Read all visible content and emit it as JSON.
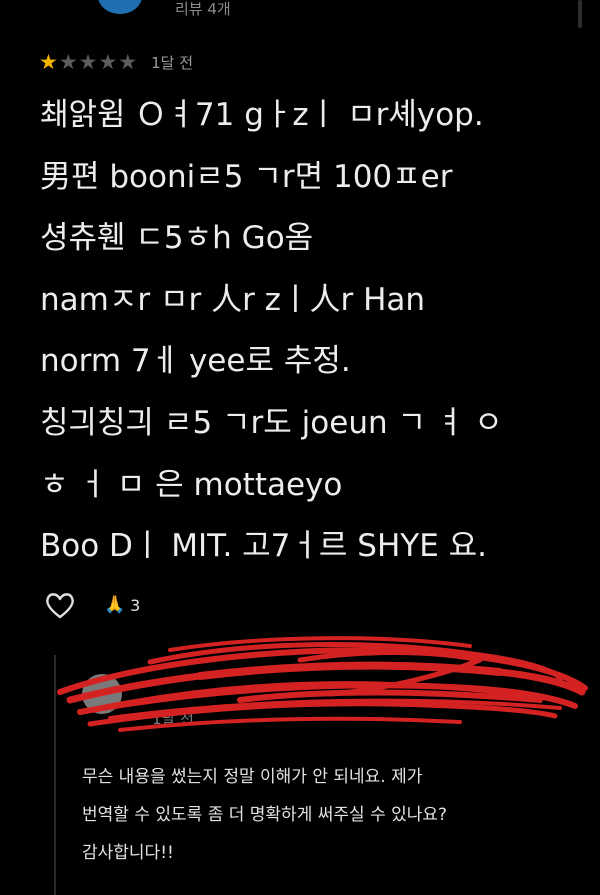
{
  "header": {
    "review_count": "리뷰 4개"
  },
  "review": {
    "rating": 1,
    "rating_max": 5,
    "age": "1달 전",
    "lines": [
      "쵀앍윔 Ｏㅕ71 gㅏzㅣ ㅁr셰yop.",
      "男편 booniㄹ5 ㄱr면 100ㅍer",
      "셩츄휀 ㄷ5ㅎh Go옴",
      "namㅈr ㅁr 人r zㅣ人r Han",
      "norm 7ㅔ yee로 추정.",
      "칭긔칭긔 ㄹ5 ㄱr도 joeun ㄱ ㅕ ㅇ",
      "ㅎ ㅓ ㅁ 은 mottaeyo",
      "Boo Dㅣ MIT. 고7ㅓ르 SHYE 요."
    ],
    "reaction_count": "3"
  },
  "reply": {
    "age": "1달 전",
    "lines": [
      "무슨 내용을 썼는지 정말 이해가 안 되네요. 제가",
      "번역할 수 있도록 좀 더 명확하게 써주실 수 있나요?",
      "감사합니다!!"
    ]
  },
  "icons": {
    "heart": "heart-outline-icon",
    "pray": "folded-hands-icon"
  },
  "colors": {
    "star_on": "#f4b400",
    "star_off": "#5c5c5c",
    "scribble": "#d42222",
    "background": "#000000"
  }
}
